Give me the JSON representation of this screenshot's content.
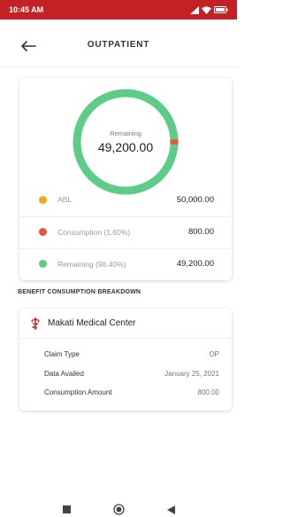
{
  "status_bar": {
    "time": "10:45 AM",
    "icons": [
      "signal-icon",
      "wifi-icon",
      "battery-icon"
    ],
    "color": "#c42127"
  },
  "header": {
    "title": "OUTPATIENT",
    "back_icon": "arrow-left-icon"
  },
  "summary": {
    "center_label": "Remaining",
    "center_value": "49,200.00",
    "consumption_fraction": 0.016,
    "rows": [
      {
        "label": "ABL",
        "value": "50,000.00",
        "color": "#f5a623"
      },
      {
        "label": "Consumption (1.60%)",
        "value": "800.00",
        "color": "#e8553c"
      },
      {
        "label": "Remaining (98.40%)",
        "value": "49,200.00",
        "color": "#5dcc86"
      }
    ]
  },
  "breakdown": {
    "title": "BENEFIT CONSUMPTION BREAKDOWN",
    "hospital": "Makati Medical Center",
    "hospital_icon": "caduceus-icon",
    "rows": [
      {
        "label": "Claim Type",
        "value": "OP"
      },
      {
        "label": "Data Availed",
        "value": "January 25, 2021"
      },
      {
        "label": "Consumption Amount",
        "value": "800.00"
      }
    ]
  },
  "nav": {
    "icons": [
      "recents-icon",
      "home-icon",
      "back-triangle-icon"
    ]
  }
}
